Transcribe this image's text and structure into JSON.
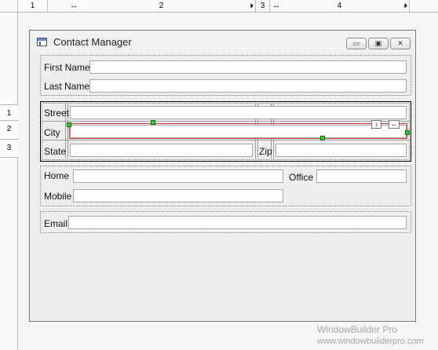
{
  "rulers": {
    "columns": [
      {
        "label": "1",
        "arrows": false
      },
      {
        "label": "2",
        "arrows": true
      },
      {
        "label": "3",
        "arrows": false
      },
      {
        "label": "4",
        "arrows": true
      }
    ],
    "rows": [
      "1",
      "2",
      "3"
    ],
    "resize_arrow": "↔",
    "end_arrow": "⏵"
  },
  "window": {
    "title": "Contact Manager",
    "controls": {
      "minimize": "▭",
      "maximize": "▣",
      "close": "✕"
    }
  },
  "name_group": {
    "first_name_label": "First Name",
    "last_name_label": "Last Name"
  },
  "address_group": {
    "street_label": "Street",
    "city_label": "City",
    "state_label": "State",
    "zip_label": "Zip"
  },
  "phone_group": {
    "home_label": "Home",
    "office_label": "Office",
    "mobile_label": "Mobile"
  },
  "email_group": {
    "email_label": "Email"
  },
  "inline_controls": {
    "expand": "↕",
    "resize": "↔"
  },
  "watermark": {
    "line1": "WindowBuilder Pro",
    "line2": "www.windowbuilderpro.com"
  }
}
